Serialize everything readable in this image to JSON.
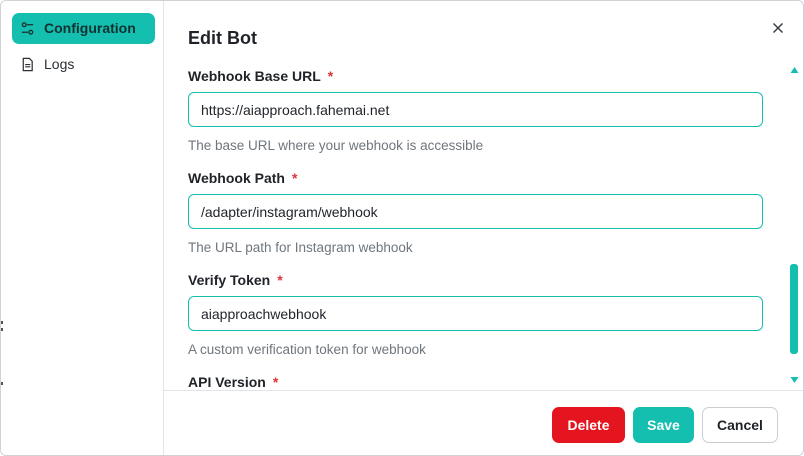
{
  "sidebar": {
    "items": [
      {
        "label": "Configuration",
        "icon": "sliders-icon",
        "active": true
      },
      {
        "label": "Logs",
        "icon": "document-icon",
        "active": false
      }
    ]
  },
  "dialog": {
    "title": "Edit Bot",
    "close_icon": "close-icon",
    "fields": [
      {
        "label": "Webhook Base URL",
        "required_mark": "*",
        "value": "https://aiapproach.fahemai.net",
        "help": "The base URL where your webhook is accessible"
      },
      {
        "label": "Webhook Path",
        "required_mark": "*",
        "value": "/adapter/instagram/webhook",
        "help": "The URL path for Instagram webhook"
      },
      {
        "label": "Verify Token",
        "required_mark": "*",
        "value": "aiapproachwebhook",
        "help": "A custom verification token for webhook"
      },
      {
        "label": "API Version",
        "required_mark": "*"
      }
    ],
    "buttons": {
      "delete": "Delete",
      "save": "Save",
      "cancel": "Cancel"
    }
  },
  "colors": {
    "accent": "#14bfb0",
    "danger": "#e4151f",
    "required": "#e0313a"
  }
}
